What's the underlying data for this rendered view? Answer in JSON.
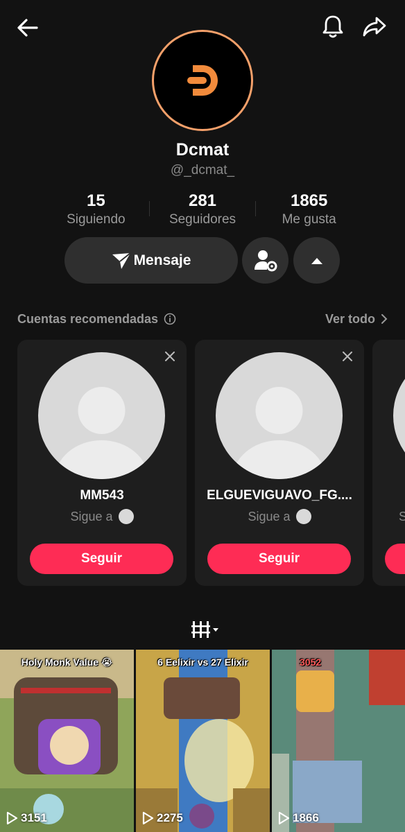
{
  "profile": {
    "name": "Dcmat",
    "handle": "@_dcmat_",
    "accent": "#F5A06A"
  },
  "stats": [
    {
      "value": "15",
      "label": "Siguiendo"
    },
    {
      "value": "281",
      "label": "Seguidores"
    },
    {
      "value": "1865",
      "label": "Me gusta"
    }
  ],
  "actions": {
    "message_label": "Mensaje"
  },
  "recommended": {
    "title": "Cuentas recomendadas",
    "see_all": "Ver todo",
    "cards": [
      {
        "name": "MM543",
        "follows_label": "Sigue a",
        "button": "Seguir"
      },
      {
        "name": "ELGUEVIGUAVO_FG....",
        "follows_label": "Sigue a",
        "button": "Seguir"
      },
      {
        "name": "",
        "follows_label": "Si",
        "button": ""
      }
    ]
  },
  "videos": [
    {
      "caption": "Holy Monk Value 😭",
      "views": "3151"
    },
    {
      "caption": "6 Eelixir vs 27 Elixir",
      "views": "2275"
    },
    {
      "caption": "3052",
      "views": "1866"
    }
  ],
  "colors": {
    "follow_button": "#fe2c55",
    "background": "#121212"
  }
}
